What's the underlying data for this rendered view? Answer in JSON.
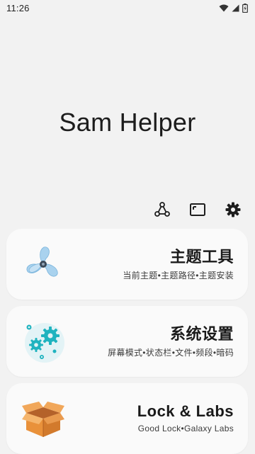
{
  "status": {
    "time": "11:26"
  },
  "app": {
    "title": "Sam Helper"
  },
  "toolbar": {
    "icons": [
      "share-nodes-icon",
      "screen-frame-icon",
      "gear-icon"
    ]
  },
  "cards": [
    {
      "title": "主题工具",
      "subtitle": "当前主题•主题路径•主题安装",
      "icon": "fan-icon",
      "accent": "#9ecbea"
    },
    {
      "title": "系统设置",
      "subtitle": "屏幕模式•状态栏•文件•频段•暗码",
      "icon": "gears-icon",
      "accent": "#1fb3bf"
    },
    {
      "title": "Lock & Labs",
      "subtitle": "Good Lock•Galaxy Labs",
      "icon": "box-icon",
      "accent": "#e9913a"
    }
  ]
}
